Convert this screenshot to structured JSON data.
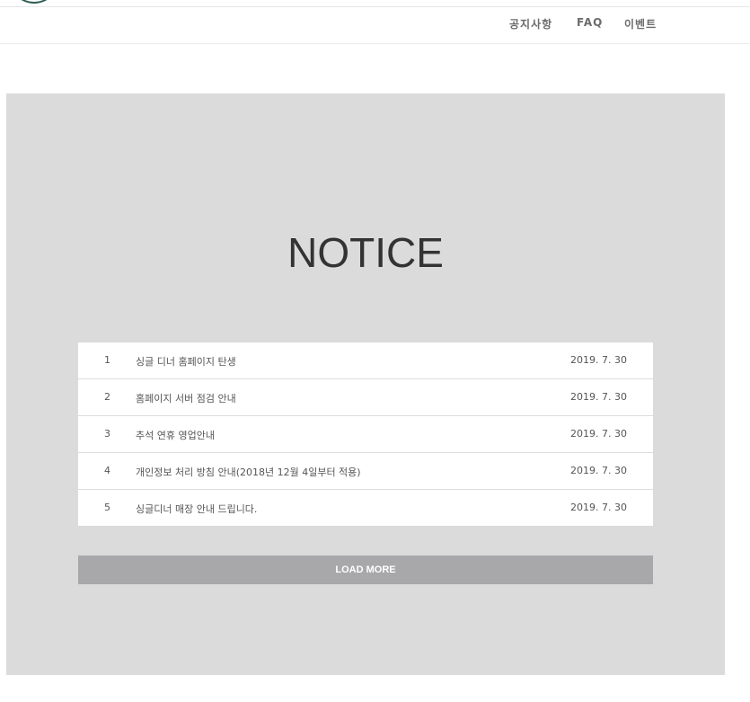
{
  "header": {
    "logo": "logo",
    "nav": [
      {
        "label": "공지사항"
      },
      {
        "label": "FAQ"
      },
      {
        "label": "이벤트"
      }
    ]
  },
  "notice": {
    "title": "NOTICE",
    "items": [
      {
        "num": "1",
        "title": "싱글 디너 홈페이지 탄생",
        "date": "2019. 7. 30"
      },
      {
        "num": "2",
        "title": "홈페이지 서버 점검 안내",
        "date": "2019. 7. 30"
      },
      {
        "num": "3",
        "title": "추석 연휴 영업안내",
        "date": "2019. 7. 30"
      },
      {
        "num": "4",
        "title": "개인정보 처리 방침 안내(2018년 12월 4일부터 적용)",
        "date": "2019. 7. 30"
      },
      {
        "num": "5",
        "title": "싱글디너 매장 안내 드립니다.",
        "date": "2019. 7. 30"
      }
    ],
    "load_more_label": "LOAD MORE"
  },
  "colors": {
    "section_bg": "#dbdbdb",
    "button_bg": "#a8a8aa",
    "logo_ring": "#2f5e54"
  }
}
